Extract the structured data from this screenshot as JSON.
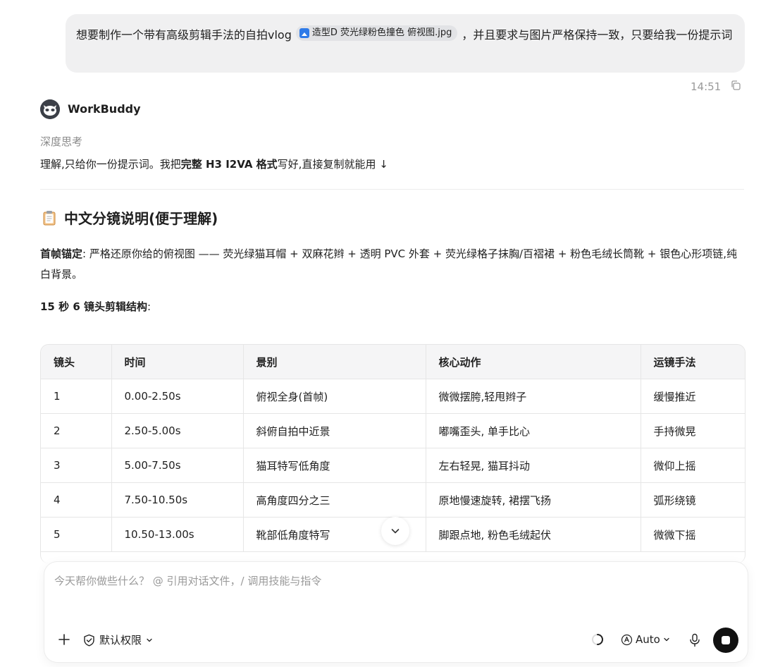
{
  "user_message": {
    "text_before": "想要制作一个带有高级剪辑手法的自拍vlog",
    "attachment": "造型D 荧光绿粉色撞色 俯视图.jpg",
    "text_after": "，并且要求与图片严格保持一致，只要给我一份提示词",
    "time": "14:51"
  },
  "assistant": {
    "name": "WorkBuddy",
    "thinking_label": "深度思考",
    "answer_part1": "理解,只给你一份提示词。我把",
    "answer_bold1": "完整 H3 I2VA 格式",
    "answer_part2": "写好,直接复制就能用 ↓",
    "section_title": "中文分镜说明(便于理解)",
    "para1_bold": "首帧锚定",
    "para1_text": ": 严格还原你给的俯视图 —— 荧光绿猫耳帽 + 双麻花辫 + 透明 PVC 外套 + 荧光绿格子抹胸/百褶裙 + 粉色毛绒长筒靴 + 银色心形项链,纯白背景。",
    "para2_bold": "15 秒 6 镜头剪辑结构",
    "para2_text": ":",
    "table": {
      "headers": [
        "镜头",
        "时间",
        "景别",
        "核心动作",
        "运镜手法"
      ],
      "rows": [
        [
          "1",
          "0.00-2.50s",
          "俯视全身(首帧)",
          "微微摆胯,轻甩辫子",
          "缓慢推近"
        ],
        [
          "2",
          "2.50-5.00s",
          "斜俯自拍中近景",
          "嘟嘴歪头, 单手比心",
          "手持微晃"
        ],
        [
          "3",
          "5.00-7.50s",
          "猫耳特写低角度",
          "左右轻晃, 猫耳抖动",
          "微仰上摇"
        ],
        [
          "4",
          "7.50-10.50s",
          "高角度四分之三",
          "原地慢速旋转, 裙摆飞扬",
          "弧形绕镜"
        ],
        [
          "5",
          "10.50-13.00s",
          "靴部低角度特写",
          "脚跟点地, 粉色毛绒起伏",
          "微微下摇"
        ]
      ]
    }
  },
  "composer": {
    "placeholder": "今天帮你做些什么？ @ 引用对话文件，/ 调用技能与指令",
    "permission_label": "默认权限",
    "model_label": "Auto"
  },
  "icons": {
    "copy": "copy-icon",
    "clipboard": "clipboard-icon",
    "chevron_down": "chevron-down-icon",
    "plus": "plus-icon",
    "shield": "shield-check-icon",
    "spinner": "spinner-icon",
    "mic": "microphone-icon",
    "stop": "stop-icon",
    "image": "image-file-icon"
  },
  "colors": {
    "bubble": "#f0f0f1",
    "accent": "#2f7be8",
    "stop_button": "#111111"
  }
}
